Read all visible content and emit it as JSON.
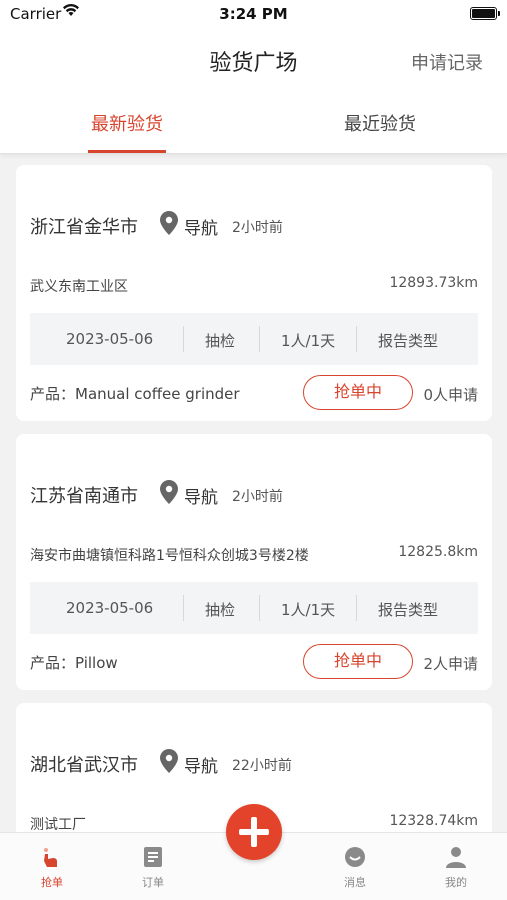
{
  "status_bar": {
    "carrier": "Carrier",
    "time": "3:24 PM"
  },
  "nav": {
    "title": "验货广场",
    "action": "申请记录"
  },
  "tabs": [
    {
      "label": "最新验货",
      "active": true
    },
    {
      "label": "最近验货",
      "active": false
    }
  ],
  "cards": [
    {
      "city": "浙江省金华市",
      "nav_label": "导航",
      "time_ago": "2小时前",
      "address": "武义东南工业区",
      "distance": "12893.73km",
      "date": "2023-05-06",
      "inspection_type": "抽检",
      "manday": "1人/1天",
      "report": "报告类型",
      "product": "产品：Manual coffee grinder",
      "button": "抢单中",
      "applicants": "0人申请"
    },
    {
      "city": "江苏省南通市",
      "nav_label": "导航",
      "time_ago": "2小时前",
      "address": "海安市曲塘镇恒科路1号恒科众创城3号楼2楼",
      "distance": "12825.8km",
      "date": "2023-05-06",
      "inspection_type": "抽检",
      "manday": "1人/1天",
      "report": "报告类型",
      "product": "产品：Pillow",
      "button": "抢单中",
      "applicants": "2人申请"
    },
    {
      "city": "湖北省武汉市",
      "nav_label": "导航",
      "time_ago": "22小时前",
      "address": "测试工厂",
      "distance": "12328.74km"
    }
  ],
  "tab_bar": [
    {
      "label": "抢单",
      "icon": "hand-tap-icon",
      "active": true
    },
    {
      "label": "订单",
      "icon": "order-list-icon",
      "active": false
    },
    {
      "label": "",
      "icon": "add-icon",
      "active": false
    },
    {
      "label": "消息",
      "icon": "message-icon",
      "active": false
    },
    {
      "label": "我的",
      "icon": "user-icon",
      "active": false
    }
  ],
  "colors": {
    "accent": "#d8452e",
    "fab": "#e3432a"
  }
}
